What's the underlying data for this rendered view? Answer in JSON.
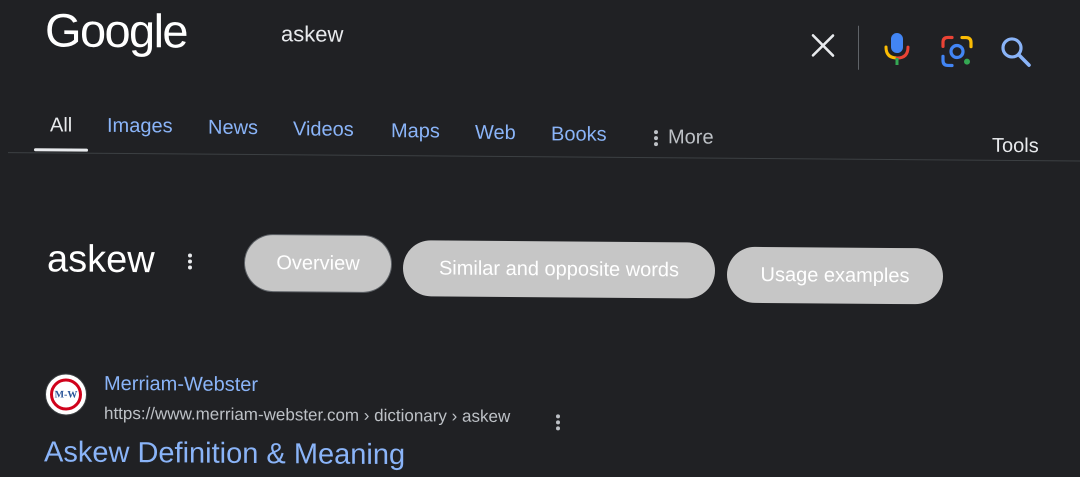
{
  "header": {
    "logo_text": "Google",
    "query": "askew",
    "icons": [
      "close-icon",
      "mic-icon",
      "lens-icon",
      "search-icon"
    ]
  },
  "tabs": {
    "items": [
      {
        "label": "All",
        "active": true
      },
      {
        "label": "Images"
      },
      {
        "label": "News"
      },
      {
        "label": "Videos"
      },
      {
        "label": "Maps"
      },
      {
        "label": "Web"
      },
      {
        "label": "Books"
      },
      {
        "label": "More"
      }
    ],
    "tools_label": "Tools"
  },
  "dictionary": {
    "word": "askew",
    "chips": [
      {
        "label": "Overview",
        "selected": true
      },
      {
        "label": "Similar and opposite words"
      },
      {
        "label": "Usage examples"
      }
    ]
  },
  "result": {
    "favicon_text": "M-W",
    "site_name": "Merriam-Webster",
    "url": "https://www.merriam-webster.com › dictionary › askew",
    "title": "Askew Definition & Meaning"
  },
  "colors": {
    "background": "#202124",
    "link": "#8ab4f8",
    "text": "#e8eaed",
    "chip_bg": "#c6c6c6",
    "google_blue": "#4285f4",
    "google_red": "#ea4335",
    "google_yellow": "#fbbc04",
    "google_green": "#34a853"
  }
}
